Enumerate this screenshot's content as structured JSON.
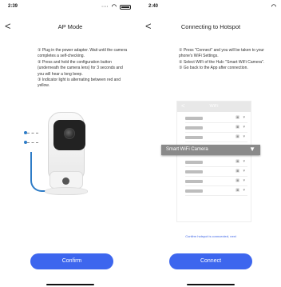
{
  "left": {
    "status": {
      "time": "2:39"
    },
    "nav": {
      "back_icon": "chevron-left-icon",
      "back": "<",
      "title": "AP Mode"
    },
    "instructions": [
      "① Plug in the power adapter. Wait until the camera completes a self-checking.",
      "② Press and hold the configuration button (underneath the camera lens) for 3 seconds and you will hear a long beep.",
      "③ Indicator light is alternating between red and yellow."
    ],
    "button": {
      "label": "Confirm"
    }
  },
  "right": {
    "status": {
      "time": "2:40"
    },
    "nav": {
      "back_icon": "chevron-left-icon",
      "back": "<",
      "title": "Connecting to Hotspot"
    },
    "instructions": [
      "① Press \"Connect\" and you will be taken to your phone's WiFi Settings.",
      "② Select WiFi of the Hub: \"Smart WiFi Camera\".",
      "③ Go back to the App after connection."
    ],
    "wifi_illustration": {
      "back": "<",
      "title": "WiFi",
      "highlighted_network": "Smart WiFi Camera",
      "signal_glyph": "▼",
      "lock_glyph": "🔒",
      "row_signal_glyph": "▾"
    },
    "hint": "Confirm hotspot is conncected, next",
    "button": {
      "label": "Connect"
    }
  },
  "colors": {
    "primary_button": "#3d66ee",
    "hint_text": "#3b63e6",
    "cable": "#2e7cc7"
  },
  "icons": {
    "wifi": "wifi-icon",
    "battery": "battery-icon",
    "signal": "signal-icon"
  }
}
